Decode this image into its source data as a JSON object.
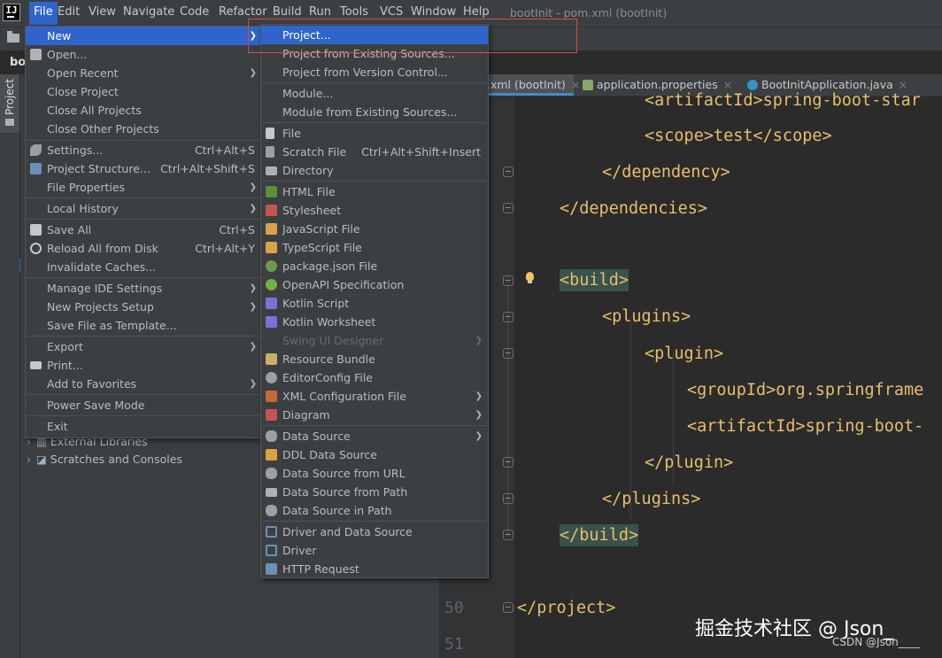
{
  "window_title": "bootInit - pom.xml (bootInit)",
  "menubar": [
    "File",
    "Edit",
    "View",
    "Navigate",
    "Code",
    "Refactor",
    "Build",
    "Run",
    "Tools",
    "VCS",
    "Window",
    "Help"
  ],
  "project_short": "bo",
  "tool_window_label": "Project",
  "tabs": [
    {
      "label": ".xml (bootInit)"
    },
    {
      "label": "application.properties"
    },
    {
      "label": "BootInitApplication.java"
    }
  ],
  "file_menu": [
    {
      "label": "New",
      "arrow": true,
      "selected": true,
      "icon": ""
    },
    {
      "label": "Open...",
      "icon": "folder-icon"
    },
    {
      "label": "Open Recent",
      "arrow": true
    },
    {
      "label": "Close Project"
    },
    {
      "label": "Close All Projects"
    },
    {
      "label": "Close Other Projects"
    },
    {
      "label": "Settings...",
      "shortcut": "Ctrl+Alt+S",
      "icon": "wrench-icon"
    },
    {
      "label": "Project Structure...",
      "shortcut": "Ctrl+Alt+Shift+S",
      "icon": "project-structure-icon"
    },
    {
      "label": "File Properties",
      "arrow": true
    },
    {
      "label": "Local History",
      "arrow": true
    },
    {
      "label": "Save All",
      "shortcut": "Ctrl+S",
      "icon": "save-icon"
    },
    {
      "label": "Reload All from Disk",
      "shortcut": "Ctrl+Alt+Y",
      "icon": "reload-icon"
    },
    {
      "label": "Invalidate Caches..."
    },
    {
      "label": "Manage IDE Settings",
      "arrow": true
    },
    {
      "label": "New Projects Setup",
      "arrow": true
    },
    {
      "label": "Save File as Template..."
    },
    {
      "label": "Export",
      "arrow": true
    },
    {
      "label": "Print...",
      "icon": "print-icon"
    },
    {
      "label": "Add to Favorites",
      "arrow": true
    },
    {
      "label": "Power Save Mode"
    },
    {
      "label": "Exit"
    }
  ],
  "new_menu": [
    {
      "label": "Project...",
      "selected": true
    },
    {
      "label": "Project from Existing Sources..."
    },
    {
      "label": "Project from Version Control..."
    },
    {
      "label": "Module..."
    },
    {
      "label": "Module from Existing Sources..."
    },
    {
      "label": "File",
      "icon": "file-icon"
    },
    {
      "label": "Scratch File",
      "shortcut": "Ctrl+Alt+Shift+Insert",
      "icon": "scratch-file-icon"
    },
    {
      "label": "Directory",
      "icon": "directory-icon"
    },
    {
      "label": "HTML File",
      "icon": "html-file-icon"
    },
    {
      "label": "Stylesheet",
      "icon": "css-file-icon"
    },
    {
      "label": "JavaScript File",
      "icon": "js-file-icon"
    },
    {
      "label": "TypeScript File",
      "icon": "ts-file-icon"
    },
    {
      "label": "package.json File",
      "icon": "nodejs-icon"
    },
    {
      "label": "OpenAPI Specification",
      "icon": "openapi-icon"
    },
    {
      "label": "Kotlin Script",
      "icon": "kotlin-icon"
    },
    {
      "label": "Kotlin Worksheet",
      "icon": "kotlin-worksheet-icon"
    },
    {
      "label": "Swing UI Designer",
      "arrow": true,
      "disabled": true
    },
    {
      "label": "Resource Bundle",
      "icon": "resource-bundle-icon"
    },
    {
      "label": "EditorConfig File",
      "icon": "gear-icon"
    },
    {
      "label": "XML Configuration File",
      "arrow": true,
      "icon": "xml-icon"
    },
    {
      "label": "Diagram",
      "arrow": true,
      "icon": "diagram-icon"
    },
    {
      "label": "Data Source",
      "arrow": true,
      "icon": "database-icon"
    },
    {
      "label": "DDL Data Source",
      "icon": "ddl-icon"
    },
    {
      "label": "Data Source from URL",
      "icon": "database-url-icon"
    },
    {
      "label": "Data Source from Path",
      "icon": "folder-icon"
    },
    {
      "label": "Data Source in Path",
      "icon": "database-icon"
    },
    {
      "label": "Driver and Data Source",
      "icon": "driver-icon"
    },
    {
      "label": "Driver",
      "icon": "driver-icon"
    },
    {
      "label": "HTTP Request",
      "icon": "api-icon"
    }
  ],
  "tree": [
    {
      "label": "External Libraries"
    },
    {
      "label": "Scratches and Consoles"
    }
  ],
  "code": [
    {
      "text": "<artifactId>spring-boot-star"
    },
    {
      "text": "<scope>test</scope>"
    },
    {
      "text": "</dependency>"
    },
    {
      "text": "</dependencies>"
    },
    {
      "text": "<build>"
    },
    {
      "text": "<plugins>"
    },
    {
      "text": "<plugin>"
    },
    {
      "text": "<groupId>org.springframe"
    },
    {
      "text": "<artifactId>spring-boot-"
    },
    {
      "text": "</plugin>"
    },
    {
      "text": "</plugins>"
    },
    {
      "text": "</build>"
    },
    {
      "text": "</project>"
    }
  ],
  "line_numbers": [
    "50",
    "51"
  ],
  "watermark": "掘金技术社区 @ Json_",
  "watermark_small": "CSDN @Json____",
  "colors": {
    "selection": "#2f65ca",
    "xml_tag": "#e8bf6a",
    "text": "#a9b7c6",
    "highlight": "#3b514d"
  }
}
